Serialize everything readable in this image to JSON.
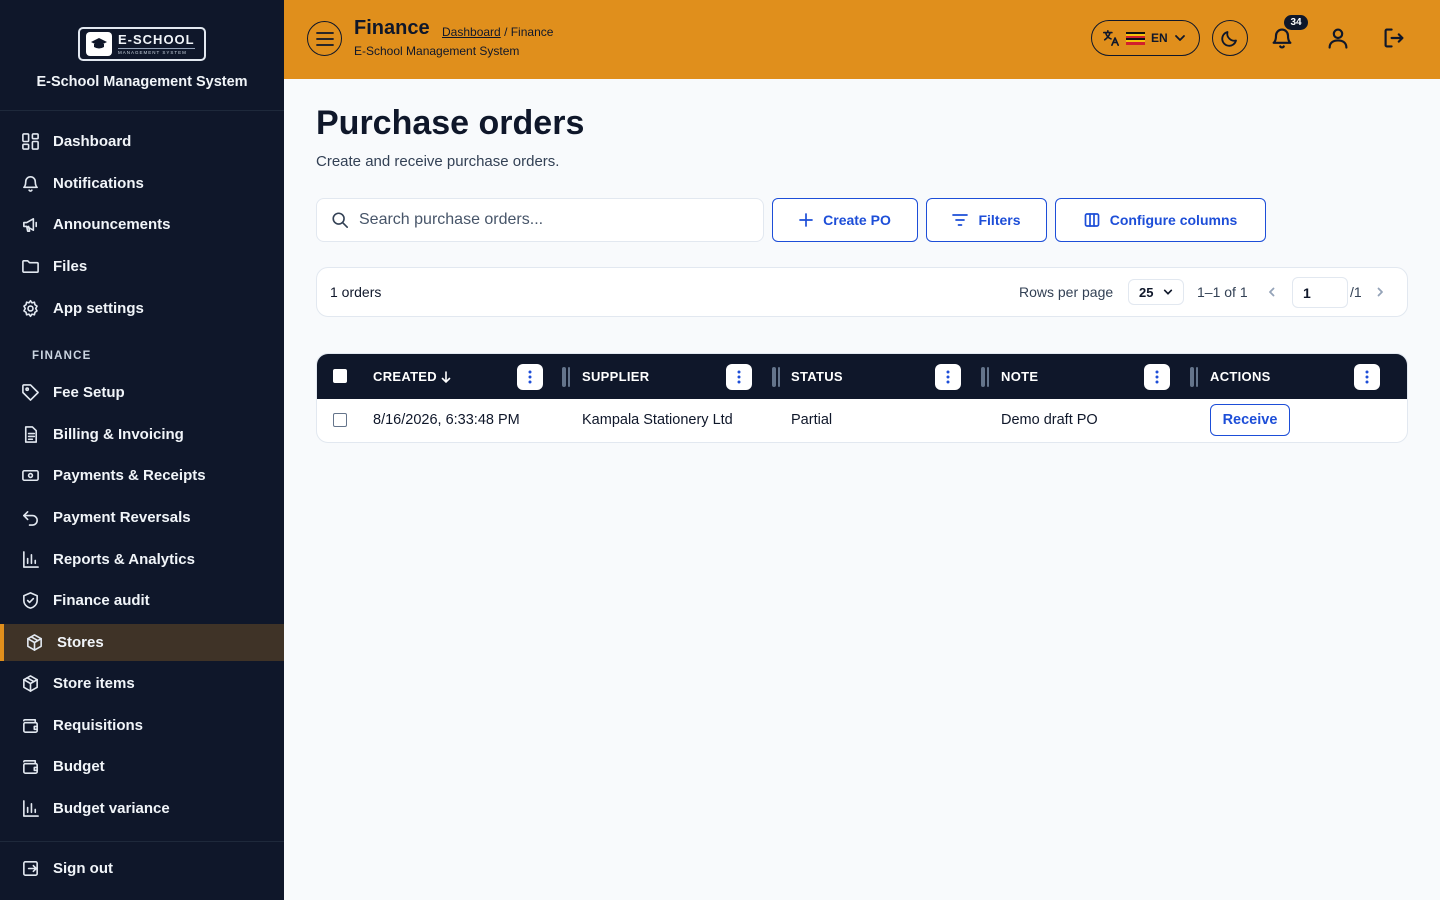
{
  "sidebar": {
    "logo_name": "E-SCHOOL",
    "logo_tagline": "MANAGEMENT SYSTEM",
    "app_title": "E-School Management System",
    "items": [
      {
        "label": "Dashboard",
        "icon": "dashboard-grid-icon"
      },
      {
        "label": "Notifications",
        "icon": "bell-icon"
      },
      {
        "label": "Announcements",
        "icon": "megaphone-icon"
      },
      {
        "label": "Files",
        "icon": "folder-icon"
      },
      {
        "label": "App settings",
        "icon": "gear-icon"
      }
    ],
    "finance_section_label": "FINANCE",
    "finance_items": [
      {
        "label": "Fee Setup",
        "icon": "tag-icon"
      },
      {
        "label": "Billing & Invoicing",
        "icon": "document-icon"
      },
      {
        "label": "Payments & Receipts",
        "icon": "banknote-icon"
      },
      {
        "label": "Payment Reversals",
        "icon": "undo-icon"
      },
      {
        "label": "Reports & Analytics",
        "icon": "bar-chart-icon"
      },
      {
        "label": "Finance audit",
        "icon": "shield-check-icon"
      },
      {
        "label": "Stores",
        "icon": "package-icon",
        "active": true
      },
      {
        "label": "Store items",
        "icon": "package-icon"
      },
      {
        "label": "Requisitions",
        "icon": "wallet-icon"
      },
      {
        "label": "Budget",
        "icon": "wallet-icon"
      },
      {
        "label": "Budget variance",
        "icon": "bar-chart-icon"
      }
    ],
    "sign_out_label": "Sign out",
    "active_color": "#e08f1c"
  },
  "header": {
    "title": "Finance",
    "breadcrumb_link": "Dashboard",
    "breadcrumb_current": "/ Finance",
    "subtitle": "E-School Management System",
    "language": "EN",
    "notification_count": "34",
    "background_color": "#e08f1c"
  },
  "main": {
    "title": "Purchase orders",
    "subtitle": "Create and receive purchase orders.",
    "search_placeholder": "Search purchase orders...",
    "create_label": "Create PO",
    "filters_label": "Filters",
    "configure_label": "Configure columns"
  },
  "pager": {
    "count_text": "1 orders",
    "rows_per_page_label": "Rows per page",
    "rows_per_page_value": "25",
    "range_text": "1–1 of 1",
    "current_page": "1",
    "total_pages_text": "/1"
  },
  "table": {
    "columns": [
      "CREATED",
      "SUPPLIER",
      "STATUS",
      "NOTE",
      "ACTIONS"
    ],
    "rows": [
      {
        "created": "8/16/2026, 6:33:48 PM",
        "supplier": "Kampala Stationery Ltd",
        "status": "Partial",
        "note": "Demo draft PO",
        "action": "Receive"
      }
    ]
  }
}
